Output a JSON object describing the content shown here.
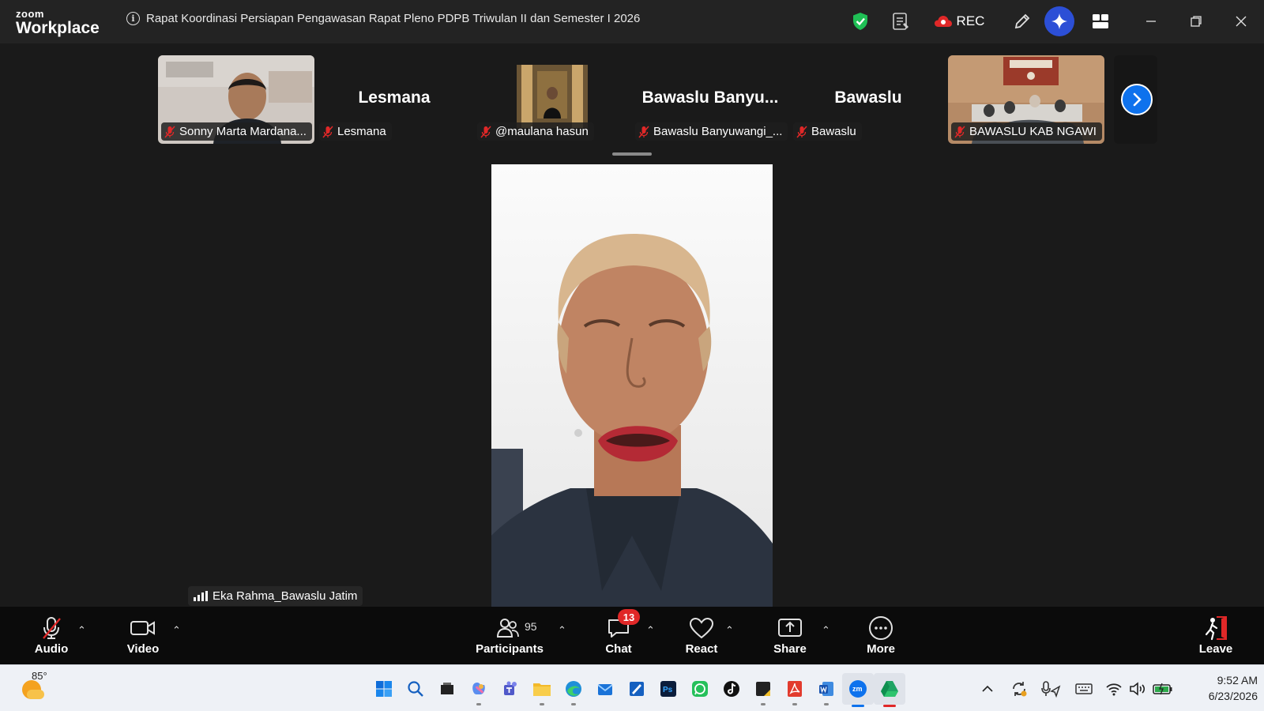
{
  "app": {
    "logo_small": "zoom",
    "logo_big": "Workplace",
    "meeting_title": "Rapat Koordinasi Persiapan Pengawasan Rapat Pleno PDPB Triwulan II dan Semester I 2026",
    "rec_label": "REC"
  },
  "thumbnails": [
    {
      "name": "Sonny Marta Mardana...",
      "video": true
    },
    {
      "name": "Lesmana",
      "big_name": "Lesmana",
      "video": false
    },
    {
      "name": "@maulana hasun",
      "video": true
    },
    {
      "name": "Bawaslu Banyuwangi_...",
      "big_name": "Bawaslu  Banyu...",
      "video": false
    },
    {
      "name": "Bawaslu",
      "big_name": "Bawaslu",
      "video": false
    },
    {
      "name": "BAWASLU KAB NGAWI",
      "video": true
    }
  ],
  "speaker": {
    "name": "Eka Rahma_Bawaslu Jatim"
  },
  "toolbar": {
    "audio": "Audio",
    "video": "Video",
    "participants": "Participants",
    "participants_count": "95",
    "chat": "Chat",
    "chat_badge": "13",
    "react": "React",
    "share": "Share",
    "more": "More",
    "leave": "Leave"
  },
  "taskbar": {
    "temperature": "85°",
    "time": "9:52 AM",
    "date": "6/23/2026"
  },
  "colors": {
    "accent": "#0e72ed",
    "record": "#e02828",
    "leave": "#e02828",
    "secure": "#1fbf55"
  }
}
